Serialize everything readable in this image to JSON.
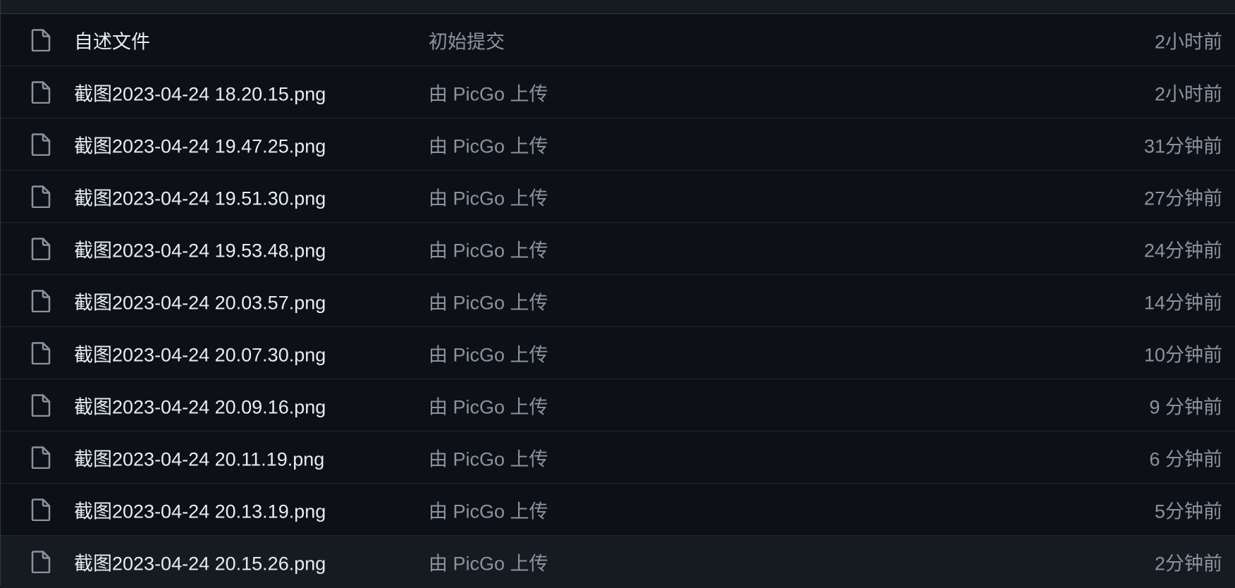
{
  "files": [
    {
      "icon": "file-icon",
      "name": "自述文件",
      "commit": "初始提交",
      "time": "2小时前"
    },
    {
      "icon": "file-icon",
      "name": "截图2023-04-24 18.20.15.png",
      "commit": "由 PicGo 上传",
      "time": "2小时前"
    },
    {
      "icon": "file-icon",
      "name": "截图2023-04-24 19.47.25.png",
      "commit": "由 PicGo 上传",
      "time": "31分钟前"
    },
    {
      "icon": "file-icon",
      "name": "截图2023-04-24 19.51.30.png",
      "commit": "由 PicGo 上传",
      "time": "27分钟前"
    },
    {
      "icon": "file-icon",
      "name": "截图2023-04-24 19.53.48.png",
      "commit": "由 PicGo 上传",
      "time": "24分钟前"
    },
    {
      "icon": "file-icon",
      "name": "截图2023-04-24 20.03.57.png",
      "commit": "由 PicGo 上传",
      "time": "14分钟前"
    },
    {
      "icon": "file-icon",
      "name": "截图2023-04-24 20.07.30.png",
      "commit": "由 PicGo 上传",
      "time": "10分钟前"
    },
    {
      "icon": "file-icon",
      "name": "截图2023-04-24 20.09.16.png",
      "commit": "由 PicGo 上传",
      "time": "9 分钟前"
    },
    {
      "icon": "file-icon",
      "name": "截图2023-04-24 20.11.19.png",
      "commit": "由 PicGo 上传",
      "time": "6 分钟前"
    },
    {
      "icon": "file-icon",
      "name": "截图2023-04-24 20.13.19.png",
      "commit": "由 PicGo 上传",
      "time": "5分钟前"
    },
    {
      "icon": "file-icon",
      "name": "截图2023-04-24 20.15.26.png",
      "commit": "由 PicGo 上传",
      "time": "2分钟前"
    }
  ],
  "colors": {
    "background": "#0d1117",
    "header": "#161b22",
    "border": "#30363d",
    "text_primary": "#e6edf3",
    "text_muted": "#8b949e"
  }
}
